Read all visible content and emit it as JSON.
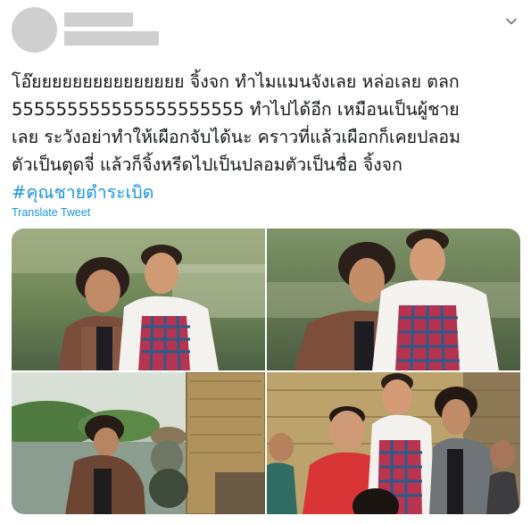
{
  "tweet": {
    "text_lines": [
      "โอ๊ยยยยยยยยยยยยยยย จิ้งจก ทำไมแมนจังเลย หล่อเลย ตลก",
      "555555555555555555555 ทำไปได้อีก เหมือนเป็นผู้ชาย",
      "เลย ระวังอย่าทำให้เผือกจับได้นะ คราวที่แล้วเผือกก็เคยปลอม",
      "ตัวเป็นตุดจี่ แล้วก็จิ้งหรีดไปเป็นปลอมตัวเป็นชื่อ จิ้งจก"
    ],
    "hashtag": "#คุณชายตำระเบิด",
    "translate_label": "Translate Tweet"
  },
  "colors": {
    "link": "#1b95e0",
    "text": "#14171a",
    "redaction": "#cfcfcf"
  },
  "icons": {
    "menu": "chevron-down-icon"
  }
}
